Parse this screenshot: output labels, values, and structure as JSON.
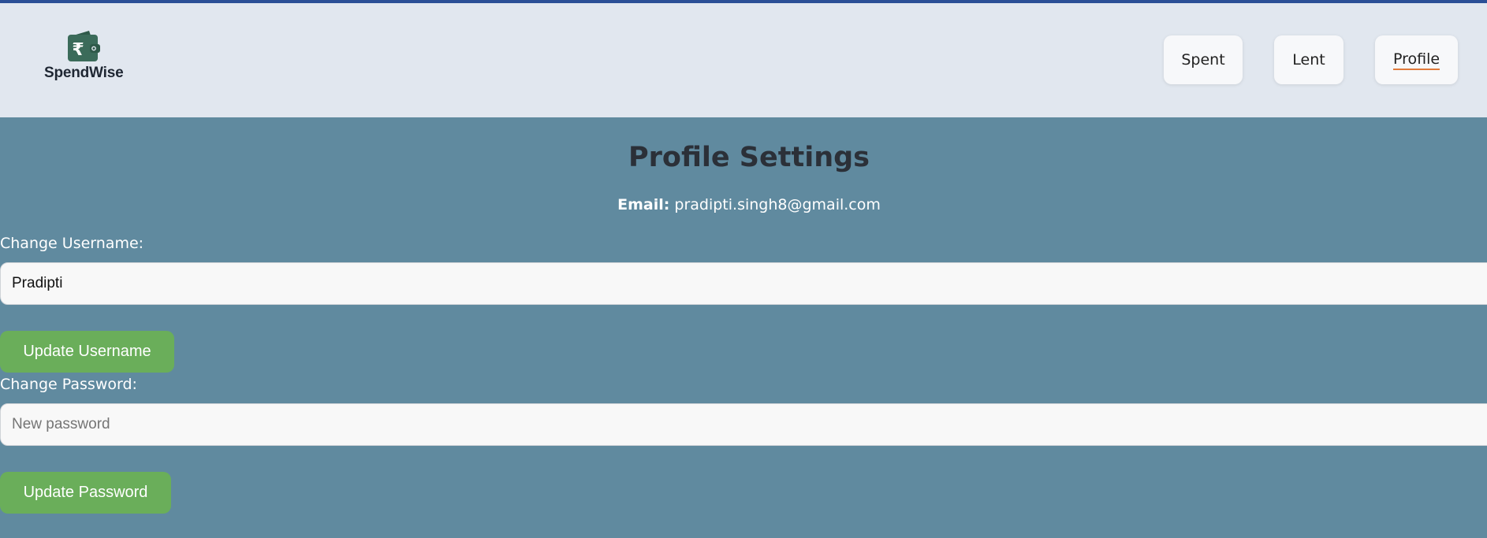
{
  "app": {
    "name": "SpendWise",
    "brand_color": "#3b6b5a",
    "logo_icon": "wallet-rupee-icon"
  },
  "nav": {
    "items": [
      {
        "label": "Spent",
        "active": false
      },
      {
        "label": "Lent",
        "active": false
      },
      {
        "label": "Profile",
        "active": true
      }
    ],
    "active_underline_color": "#e07a3c"
  },
  "page": {
    "title": "Profile Settings",
    "email_label": "Email:",
    "email_value": "pradipti.singh8@gmail.com"
  },
  "username_section": {
    "label": "Change Username:",
    "value": "Pradipti",
    "button_label": "Update Username"
  },
  "password_section": {
    "label": "Change Password:",
    "value": "",
    "placeholder": "New password",
    "button_label": "Update Password"
  },
  "colors": {
    "page_background": "#608a9f",
    "header_background": "#e1e7ef",
    "button_green": "#6aae5a",
    "top_strip": "#2b4f96"
  }
}
